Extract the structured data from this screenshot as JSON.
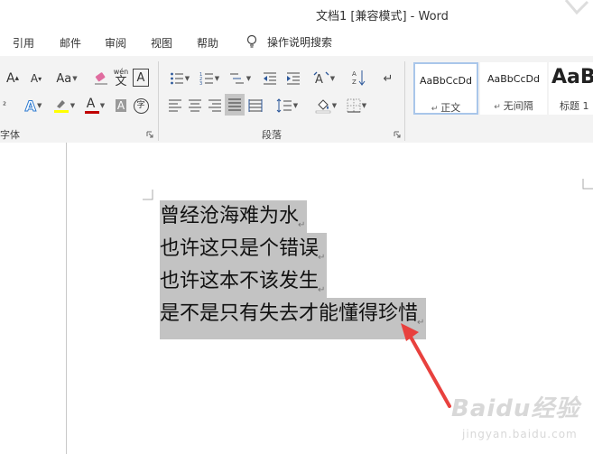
{
  "window": {
    "title": "文档1 [兼容模式]  -  Word"
  },
  "menu": {
    "items": [
      "引用",
      "邮件",
      "审阅",
      "视图",
      "帮助"
    ],
    "tell_me": "操作说明搜索"
  },
  "ribbon": {
    "groups": {
      "font_label": "字体",
      "paragraph_label": "段落"
    },
    "font": {
      "grow": "A",
      "shrink": "A",
      "case": "Aa",
      "phonetic": "wén",
      "phonetic_char": "文",
      "border_char": "A",
      "effects": "A",
      "color": "A",
      "enclose": "字"
    },
    "styles": [
      {
        "sample": "AaBbCcDd",
        "name": "正文"
      },
      {
        "sample": "AaBbCcDd",
        "name": "无间隔"
      },
      {
        "sample": "AaB",
        "name": "标题 1"
      }
    ],
    "paragraph_mark": "↵",
    "accent_color": "#2b579a",
    "highlight_color": "#ffff00",
    "font_color": "#c00000"
  },
  "document": {
    "lines": [
      "曾经沧海难为水",
      "也许这只是个错误",
      "也许这本不该发生",
      "是不是只有失去才能懂得珍惜"
    ],
    "selection_color": "#c3c3c3"
  },
  "watermark": {
    "brand": "Baidu经验",
    "url": "jingyan.baidu.com"
  }
}
